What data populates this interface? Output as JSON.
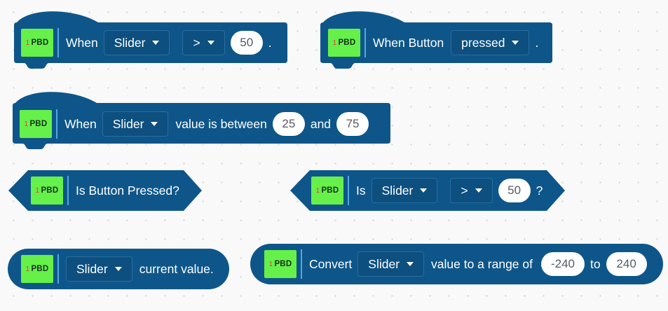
{
  "badge": {
    "num": "1",
    "label": "PBD"
  },
  "colors": {
    "block": "#0e5689",
    "badge": "#66f04a",
    "separator": "#52a7e0",
    "dropdown": "#0d4f7f"
  },
  "block1": {
    "when": "When",
    "sensor": "Slider",
    "operator": ">",
    "value": "50",
    "end": "."
  },
  "block2": {
    "when": "When Button",
    "state": "pressed",
    "end": "."
  },
  "block3": {
    "when": "When",
    "sensor": "Slider",
    "between": "value is between",
    "low": "25",
    "and": "and",
    "high": "75"
  },
  "block4": {
    "label": "Is Button Pressed?"
  },
  "block5": {
    "is": "Is",
    "sensor": "Slider",
    "operator": ">",
    "value": "50",
    "q": "?"
  },
  "block6": {
    "sensor": "Slider",
    "label": "current value."
  },
  "block7": {
    "convert": "Convert",
    "sensor": "Slider",
    "range_label": "value to a range of",
    "low": "-240",
    "to": "to",
    "high": "240"
  }
}
